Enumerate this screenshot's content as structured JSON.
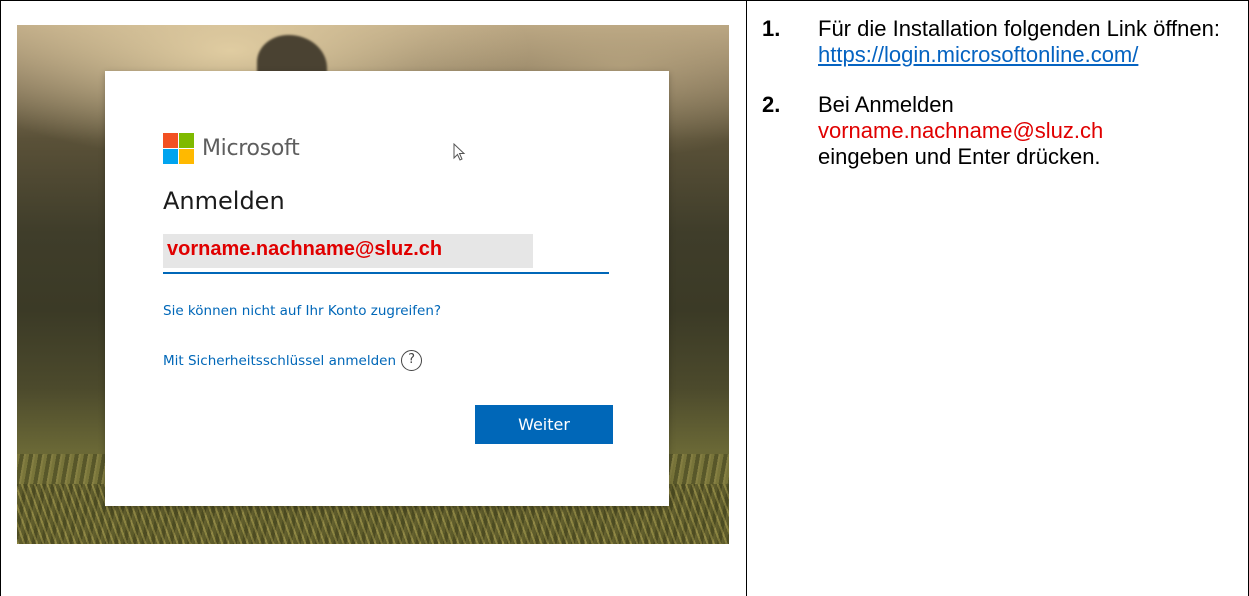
{
  "login": {
    "brand": "Microsoft",
    "heading": "Anmelden",
    "email_value": "vorname.nachname@sluz.ch",
    "cant_access_link": "Sie können nicht auf Ihr Konto zugreifen?",
    "security_key_link": "Mit Sicherheitsschlüssel anmelden",
    "help_symbol": "?",
    "next_button": "Weiter"
  },
  "instructions": {
    "step1": {
      "number": "1.",
      "text": "Für die Installation folgenden Link öffnen:",
      "link": "https://login.microsoftonline.com/"
    },
    "step2": {
      "number": "2.",
      "text_before": "Bei Anmelden",
      "email": "vorname.nachname@sluz.ch",
      "text_after": "eingeben und Enter drücken."
    }
  },
  "colors": {
    "ms_blue": "#0067b8",
    "highlight_red": "#e00000",
    "link_blue": "#0563c1",
    "logo_red": "#f25022",
    "logo_green": "#7fba00",
    "logo_blue": "#00a4ef",
    "logo_yellow": "#ffb900"
  },
  "icons": [
    "microsoft-logo-icon",
    "mouse-cursor-icon",
    "help-circle-icon"
  ]
}
